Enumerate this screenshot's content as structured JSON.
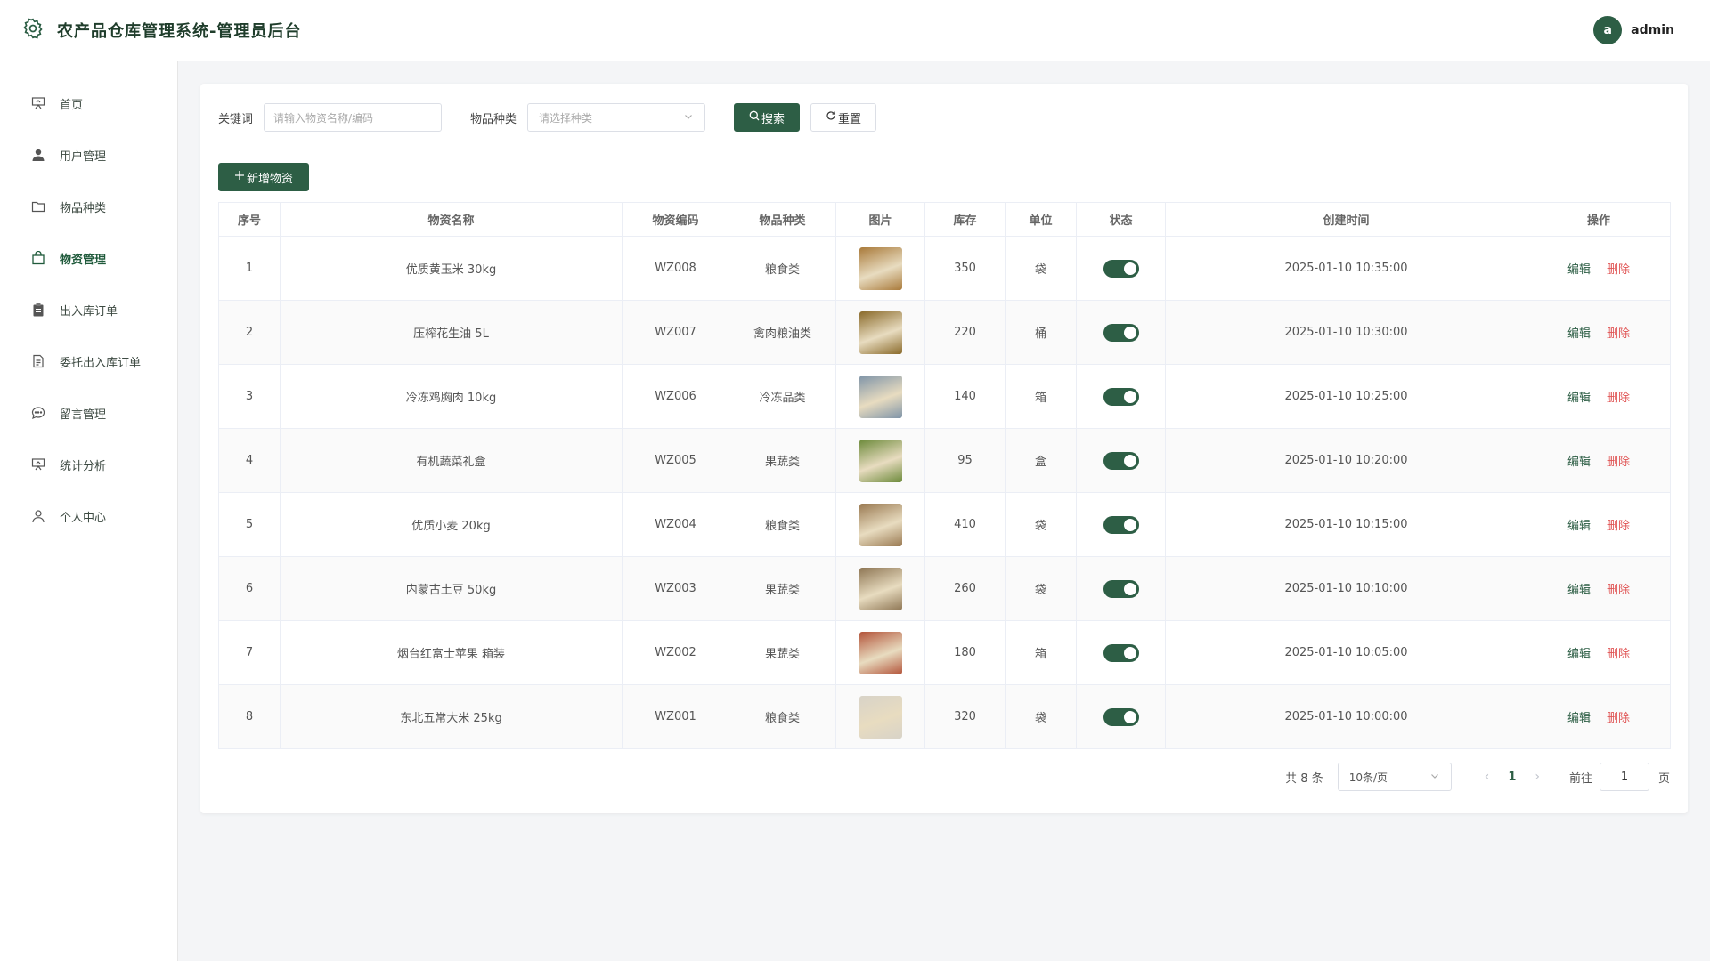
{
  "header": {
    "title": "农产品仓库管理系统-管理员后台",
    "avatar_letter": "a",
    "username": "admin"
  },
  "sidebar": {
    "items": [
      {
        "label": "首页",
        "icon": "presentation-icon",
        "active": false
      },
      {
        "label": "用户管理",
        "icon": "user-icon",
        "active": false
      },
      {
        "label": "物品种类",
        "icon": "folder-icon",
        "active": false
      },
      {
        "label": "物资管理",
        "icon": "shopping-bag-icon",
        "active": true
      },
      {
        "label": "出入库订单",
        "icon": "clipboard-icon",
        "active": false
      },
      {
        "label": "委托出入库订单",
        "icon": "document-icon",
        "active": false
      },
      {
        "label": "留言管理",
        "icon": "chat-bubble-icon",
        "active": false
      },
      {
        "label": "统计分析",
        "icon": "presentation-icon",
        "active": false
      },
      {
        "label": "个人中心",
        "icon": "user-outline-icon",
        "active": false
      }
    ]
  },
  "filters": {
    "keyword_label": "关键词",
    "keyword_placeholder": "请输入物资名称/编码",
    "category_label": "物品种类",
    "category_placeholder": "请选择种类",
    "search_label": "搜索",
    "reset_label": "重置"
  },
  "toolbar": {
    "add_label": "新增物资"
  },
  "table": {
    "headers": [
      "序号",
      "物资名称",
      "物资编码",
      "物品种类",
      "图片",
      "库存",
      "单位",
      "状态",
      "创建时间",
      "操作"
    ],
    "edit_label": "编辑",
    "delete_label": "删除",
    "rows": [
      {
        "no": "1",
        "name": "优质黄玉米 30kg",
        "code": "WZ008",
        "category": "粮食类",
        "stock": "350",
        "unit": "袋",
        "status": true,
        "created": "2025-01-10 10:35:00",
        "thumb": "#a97a3a"
      },
      {
        "no": "2",
        "name": "压榨花生油 5L",
        "code": "WZ007",
        "category": "禽肉粮油类",
        "stock": "220",
        "unit": "桶",
        "status": true,
        "created": "2025-01-10 10:30:00",
        "thumb": "#8a6a2a"
      },
      {
        "no": "3",
        "name": "冷冻鸡胸肉 10kg",
        "code": "WZ006",
        "category": "冷冻品类",
        "stock": "140",
        "unit": "箱",
        "status": true,
        "created": "2025-01-10 10:25:00",
        "thumb": "#7f94a8"
      },
      {
        "no": "4",
        "name": "有机蔬菜礼盒",
        "code": "WZ005",
        "category": "果蔬类",
        "stock": "95",
        "unit": "盒",
        "status": true,
        "created": "2025-01-10 10:20:00",
        "thumb": "#6c8a3a"
      },
      {
        "no": "5",
        "name": "优质小麦 20kg",
        "code": "WZ004",
        "category": "粮食类",
        "stock": "410",
        "unit": "袋",
        "status": true,
        "created": "2025-01-10 10:15:00",
        "thumb": "#9a7a52"
      },
      {
        "no": "6",
        "name": "内蒙古土豆 50kg",
        "code": "WZ003",
        "category": "果蔬类",
        "stock": "260",
        "unit": "袋",
        "status": true,
        "created": "2025-01-10 10:10:00",
        "thumb": "#8e7654"
      },
      {
        "no": "7",
        "name": "烟台红富士苹果 箱装",
        "code": "WZ002",
        "category": "果蔬类",
        "stock": "180",
        "unit": "箱",
        "status": true,
        "created": "2025-01-10 10:05:00",
        "thumb": "#b3543a"
      },
      {
        "no": "8",
        "name": "东北五常大米 25kg",
        "code": "WZ001",
        "category": "粮食类",
        "stock": "320",
        "unit": "袋",
        "status": true,
        "created": "2025-01-10 10:00:00",
        "thumb": "#d8d3c8"
      }
    ]
  },
  "pagination": {
    "total_text": "共 8 条",
    "page_size": "10条/页",
    "current_page": "1",
    "goto_label": "前往",
    "goto_value": "1",
    "page_suffix": "页"
  },
  "colors": {
    "primary": "#2d5e45",
    "danger": "#e05555"
  }
}
